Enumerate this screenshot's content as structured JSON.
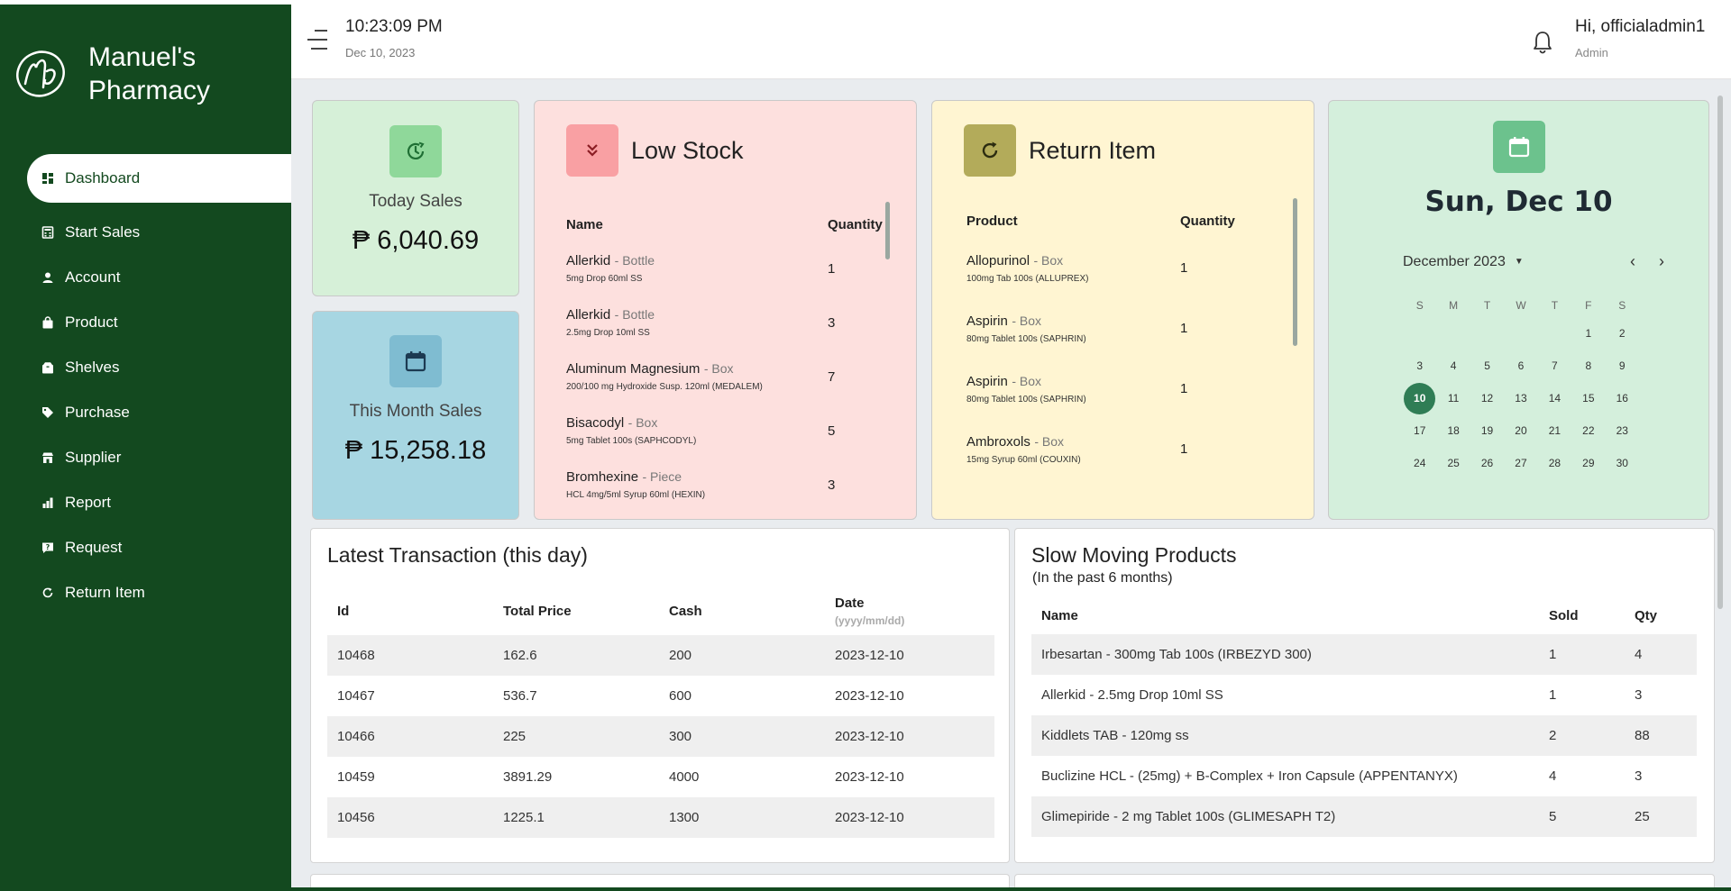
{
  "brand": {
    "line1": "Manuel's",
    "line2": "Pharmacy",
    "logo": "pharmacy-logo-md"
  },
  "header": {
    "time": "10:23:09 PM",
    "date": "Dec 10, 2023",
    "greeting": "Hi, officialadmin1",
    "role": "Admin",
    "menu_icon": "hamburger-icon",
    "bell_icon": "bell-icon"
  },
  "nav": [
    {
      "label": "Dashboard",
      "icon": "dashboard-icon",
      "active": true
    },
    {
      "label": "Start Sales",
      "icon": "calculator-icon"
    },
    {
      "label": "Account",
      "icon": "user-icon"
    },
    {
      "label": "Product",
      "icon": "bag-icon"
    },
    {
      "label": "Shelves",
      "icon": "box-icon"
    },
    {
      "label": "Purchase",
      "icon": "tag-icon"
    },
    {
      "label": "Supplier",
      "icon": "store-icon"
    },
    {
      "label": "Report",
      "icon": "bar-chart-icon"
    },
    {
      "label": "Request",
      "icon": "question-icon"
    },
    {
      "label": "Return Item",
      "icon": "refresh-icon"
    }
  ],
  "today_sales": {
    "label": "Today Sales",
    "value": "₱ 6,040.69"
  },
  "month_sales": {
    "label": "This Month Sales",
    "value": "₱ 15,258.18"
  },
  "low_stock": {
    "title": "Low Stock",
    "col_name": "Name",
    "col_qty": "Quantity",
    "rows": [
      {
        "name": "Allerkid",
        "unit": "- Bottle",
        "desc": "5mg Drop 60ml SS",
        "qty": "1"
      },
      {
        "name": "Allerkid",
        "unit": "- Bottle",
        "desc": "2.5mg Drop 10ml SS",
        "qty": "3"
      },
      {
        "name": "Aluminum Magnesium",
        "unit": "- Box",
        "desc": "200/100 mg Hydroxide Susp. 120ml (MEDALEM)",
        "qty": "7"
      },
      {
        "name": "Bisacodyl",
        "unit": "- Box",
        "desc": "5mg Tablet 100s (SAPHCODYL)",
        "qty": "5"
      },
      {
        "name": "Bromhexine",
        "unit": "- Piece",
        "desc": "HCL 4mg/5ml Syrup 60ml (HEXIN)",
        "qty": "3"
      }
    ]
  },
  "return_item": {
    "title": "Return Item",
    "col_product": "Product",
    "col_qty": "Quantity",
    "rows": [
      {
        "name": "Allopurinol",
        "unit": "- Box",
        "desc": "100mg Tab 100s (ALLUPREX)",
        "qty": "1"
      },
      {
        "name": "Aspirin",
        "unit": "- Box",
        "desc": "80mg Tablet 100s (SAPHRIN)",
        "qty": "1"
      },
      {
        "name": "Aspirin",
        "unit": "- Box",
        "desc": "80mg Tablet 100s (SAPHRIN)",
        "qty": "1"
      },
      {
        "name": "Ambroxols",
        "unit": "- Box",
        "desc": "15mg Syrup 60ml (COUXIN)",
        "qty": "1"
      }
    ]
  },
  "calendar": {
    "big_date": "Sun, Dec 10",
    "month_label": "December 2023",
    "weekdays": [
      "S",
      "M",
      "T",
      "W",
      "T",
      "F",
      "S"
    ],
    "weeks": [
      [
        "",
        "",
        "",
        "",
        "",
        "1",
        "2"
      ],
      [
        "3",
        "4",
        "5",
        "6",
        "7",
        "8",
        "9"
      ],
      [
        "10",
        "11",
        "12",
        "13",
        "14",
        "15",
        "16"
      ],
      [
        "17",
        "18",
        "19",
        "20",
        "21",
        "22",
        "23"
      ],
      [
        "24",
        "25",
        "26",
        "27",
        "28",
        "29",
        "30"
      ]
    ],
    "selected": "10"
  },
  "latest": {
    "title": "Latest Transaction (this day)",
    "headers": {
      "id": "Id",
      "total": "Total Price",
      "cash": "Cash",
      "date": "Date",
      "date_fmt": "(yyyy/mm/dd)"
    },
    "rows": [
      {
        "id": "10468",
        "total": "162.6",
        "cash": "200",
        "date": "2023-12-10"
      },
      {
        "id": "10467",
        "total": "536.7",
        "cash": "600",
        "date": "2023-12-10"
      },
      {
        "id": "10466",
        "total": "225",
        "cash": "300",
        "date": "2023-12-10"
      },
      {
        "id": "10459",
        "total": "3891.29",
        "cash": "4000",
        "date": "2023-12-10"
      },
      {
        "id": "10456",
        "total": "1225.1",
        "cash": "1300",
        "date": "2023-12-10"
      }
    ]
  },
  "slow": {
    "title": "Slow Moving Products",
    "subtitle": "(In the past 6 months)",
    "headers": {
      "name": "Name",
      "sold": "Sold",
      "qty": "Qty"
    },
    "rows": [
      {
        "name": "Irbesartan - 300mg Tab 100s (IRBEZYD 300)",
        "sold": "1",
        "qty": "4"
      },
      {
        "name": "Allerkid - 2.5mg Drop 10ml SS",
        "sold": "1",
        "qty": "3"
      },
      {
        "name": "Kiddlets TAB - 120mg ss",
        "sold": "2",
        "qty": "88"
      },
      {
        "name": "Buclizine HCL - (25mg) + B-Complex + Iron Capsule (APPENTANYX)",
        "sold": "4",
        "qty": "3"
      },
      {
        "name": "Glimepiride - 2 mg Tablet 100s (GLIMESAPH T2)",
        "sold": "5",
        "qty": "25"
      }
    ]
  },
  "colors": {
    "sidebar": "#13491f",
    "today": "#d6f0d8",
    "month": "#a7d6e2",
    "low": "#fde0de",
    "return": "#fff5d2",
    "calendar": "#d4efdc",
    "selected_day": "#2f7d55"
  }
}
